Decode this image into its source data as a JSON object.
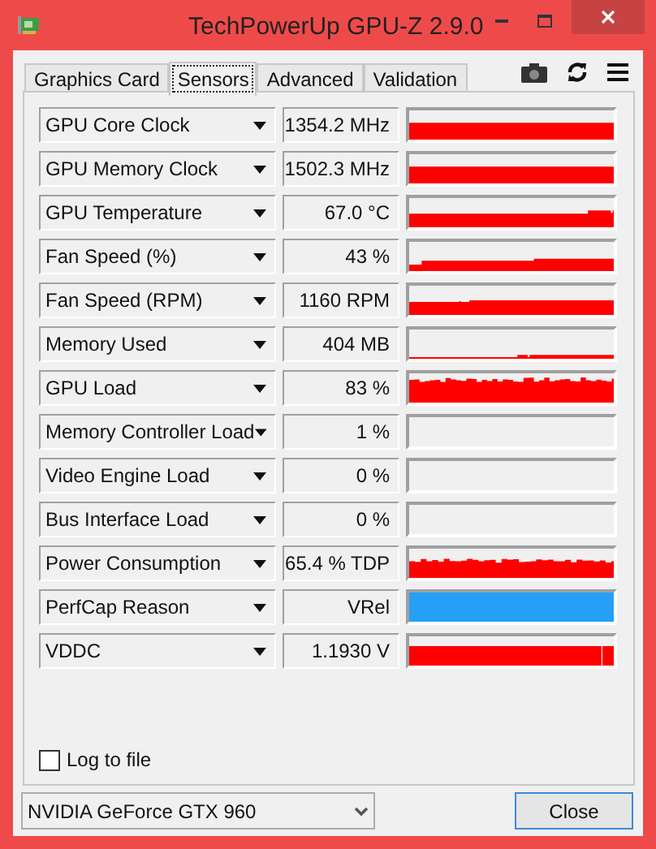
{
  "window": {
    "title": "TechPowerUp GPU-Z 2.9.0"
  },
  "tabs": [
    {
      "label": "Graphics Card",
      "selected": false
    },
    {
      "label": "Sensors",
      "selected": true
    },
    {
      "label": "Advanced",
      "selected": false
    },
    {
      "label": "Validation",
      "selected": false
    }
  ],
  "sensors": [
    {
      "name": "GPU Core Clock",
      "value": "1354.2 MHz",
      "graph": {
        "kind": "history",
        "color": "#ff0000"
      }
    },
    {
      "name": "GPU Memory Clock",
      "value": "1502.3 MHz",
      "graph": {
        "kind": "history",
        "color": "#ff0000"
      }
    },
    {
      "name": "GPU Temperature",
      "value": "67.0 °C",
      "graph": {
        "kind": "history",
        "color": "#ff0000"
      }
    },
    {
      "name": "Fan Speed (%)",
      "value": "43 %",
      "graph": {
        "kind": "history",
        "color": "#ff0000"
      }
    },
    {
      "name": "Fan Speed (RPM)",
      "value": "1160 RPM",
      "graph": {
        "kind": "history",
        "color": "#ff0000"
      }
    },
    {
      "name": "Memory Used",
      "value": "404 MB",
      "graph": {
        "kind": "history",
        "color": "#ff0000"
      }
    },
    {
      "name": "GPU Load",
      "value": "83 %",
      "graph": {
        "kind": "history",
        "color": "#ff0000"
      }
    },
    {
      "name": "Memory Controller Load",
      "value": "1 %",
      "graph": {
        "kind": "empty"
      }
    },
    {
      "name": "Video Engine Load",
      "value": "0 %",
      "graph": {
        "kind": "empty"
      }
    },
    {
      "name": "Bus Interface Load",
      "value": "0 %",
      "graph": {
        "kind": "empty"
      }
    },
    {
      "name": "Power Consumption",
      "value": "65.4 % TDP",
      "graph": {
        "kind": "history",
        "color": "#ff0000"
      }
    },
    {
      "name": "PerfCap Reason",
      "value": "VRel",
      "graph": {
        "kind": "flag",
        "color": "#26a0f7"
      }
    },
    {
      "name": "VDDC",
      "value": "1.1930 V",
      "graph": {
        "kind": "history",
        "color": "#ff0000"
      }
    }
  ],
  "log_to_file": {
    "label": "Log to file",
    "checked": false
  },
  "gpu_select": {
    "value": "NVIDIA GeForce GTX 960"
  },
  "close_button": {
    "label": "Close"
  }
}
